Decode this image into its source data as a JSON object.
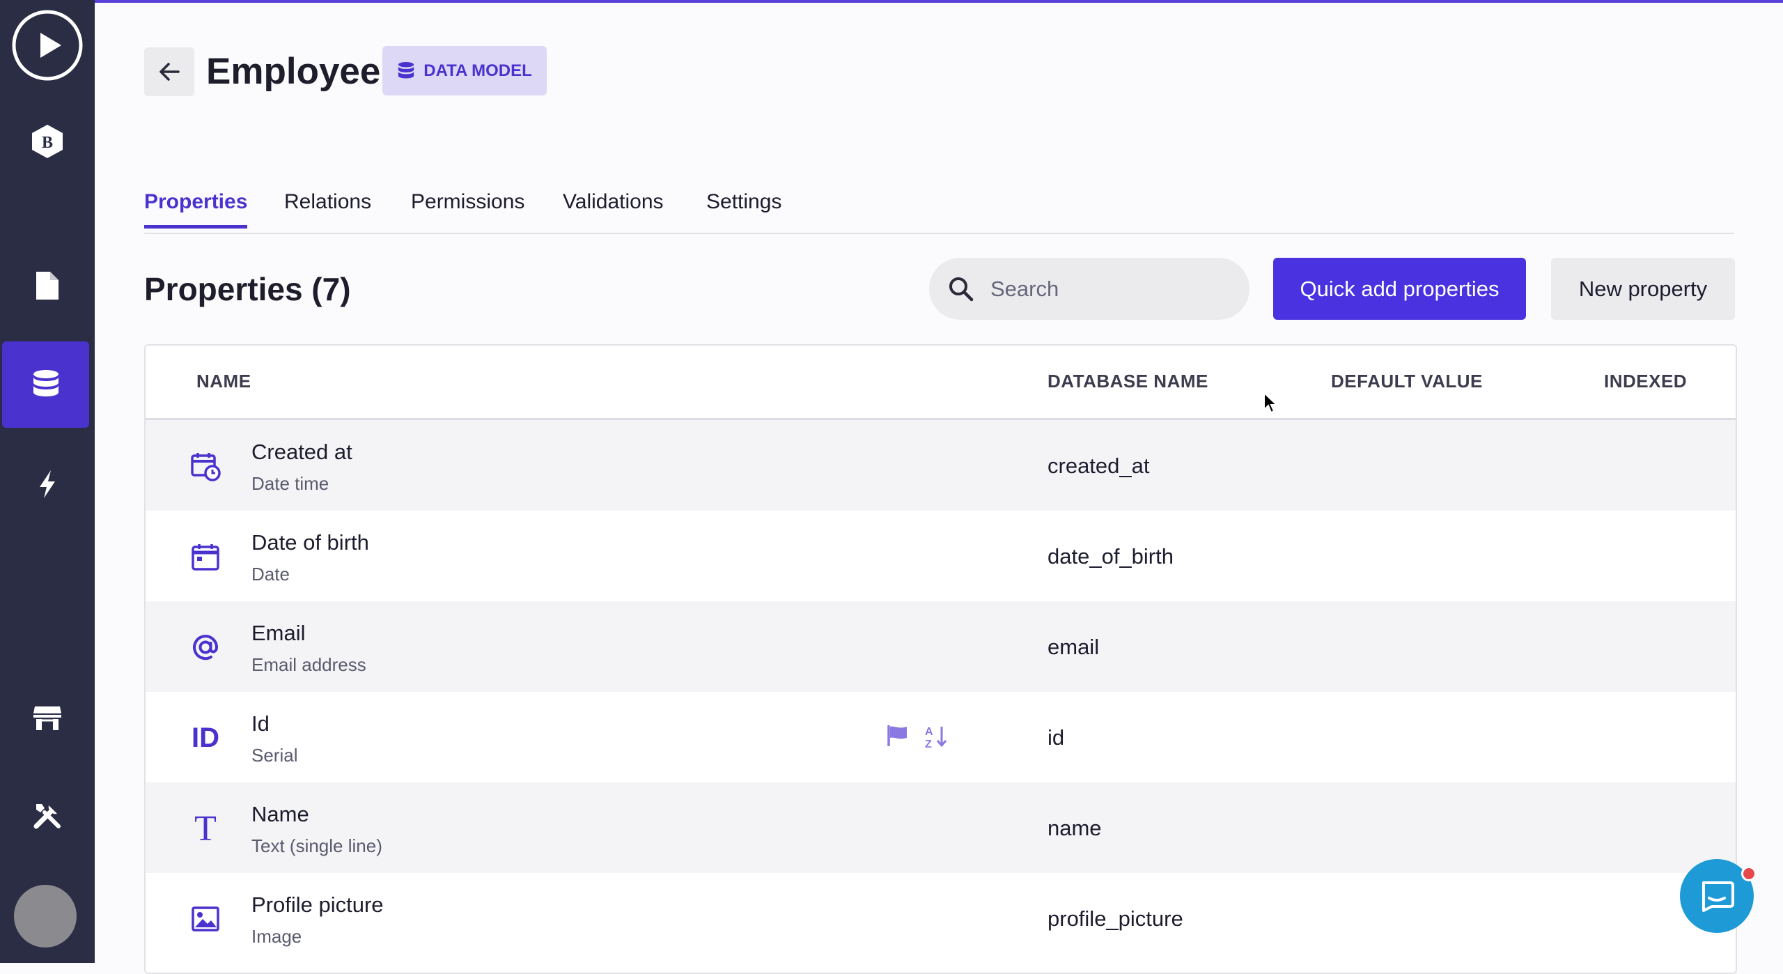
{
  "header": {
    "title": "Employee",
    "badge": "DATA MODEL"
  },
  "tabs": [
    {
      "label": "Properties",
      "active": true
    },
    {
      "label": "Relations"
    },
    {
      "label": "Permissions"
    },
    {
      "label": "Validations"
    },
    {
      "label": "Settings"
    }
  ],
  "section": {
    "title": "Properties (7)"
  },
  "search": {
    "placeholder": "Search"
  },
  "buttons": {
    "quick_add": "Quick add properties",
    "new_property": "New property"
  },
  "table": {
    "columns": {
      "name": "NAME",
      "database_name": "DATABASE NAME",
      "default_value": "DEFAULT VALUE",
      "indexed": "INDEXED"
    },
    "rows": [
      {
        "name": "Created at",
        "type": "Date time",
        "db_name": "created_at",
        "icon": "calendar-clock-icon"
      },
      {
        "name": "Date of birth",
        "type": "Date",
        "db_name": "date_of_birth",
        "icon": "calendar-icon"
      },
      {
        "name": "Email",
        "type": "Email address",
        "db_name": "email",
        "icon": "at-sign-icon"
      },
      {
        "name": "Id",
        "type": "Serial",
        "db_name": "id",
        "icon": "id-icon",
        "flags": [
          "flag-icon",
          "sort-az-icon"
        ],
        "id_label": "ID"
      },
      {
        "name": "Name",
        "type": "Text (single line)",
        "db_name": "name",
        "icon": "text-t-icon",
        "t_label": "T"
      },
      {
        "name": "Profile picture",
        "type": "Image",
        "db_name": "profile_picture",
        "icon": "image-icon"
      }
    ]
  },
  "colors": {
    "accent": "#4a32e0",
    "sidebar": "#2a2d44",
    "chat": "#1e9bd7"
  }
}
